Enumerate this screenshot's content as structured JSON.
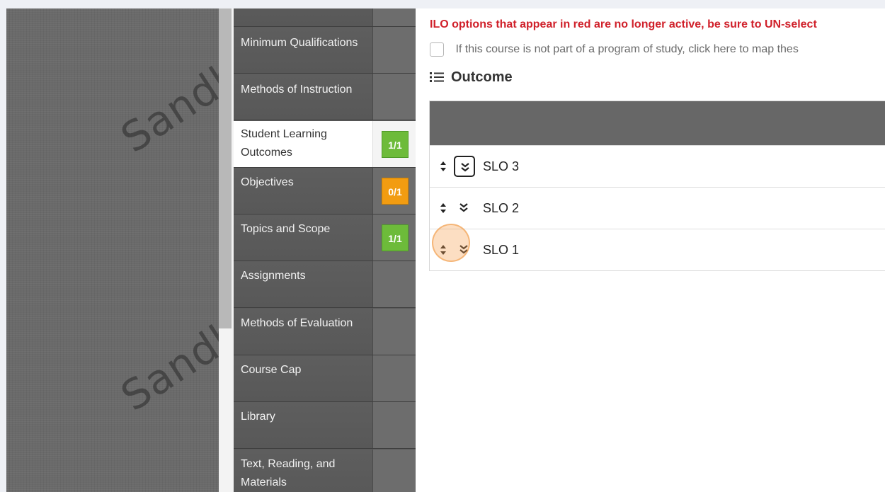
{
  "watermark": {
    "text": "Sandbo"
  },
  "nav": {
    "items": [
      {
        "label": "Minimum Qualifications",
        "badge": null,
        "active": false
      },
      {
        "label": "Methods of Instruction",
        "badge": null,
        "active": false
      },
      {
        "label": "Student Learning Outcomes",
        "badge": "1/1",
        "badge_color": "#6dbb3a",
        "active": true
      },
      {
        "label": "Objectives",
        "badge": "0/1",
        "badge_color": "#f29c11",
        "active": false
      },
      {
        "label": "Topics and Scope",
        "badge": "1/1",
        "badge_color": "#6dbb3a",
        "active": false
      },
      {
        "label": "Assignments",
        "badge": null,
        "active": false
      },
      {
        "label": "Methods of Evaluation",
        "badge": null,
        "active": false
      },
      {
        "label": "Course Cap",
        "badge": null,
        "active": false
      },
      {
        "label": "Library",
        "badge": null,
        "active": false
      },
      {
        "label": "Text, Reading, and Materials",
        "badge": null,
        "active": false
      }
    ]
  },
  "main": {
    "notice": "ILO options that appear in red are no longer active, be sure to UN-select",
    "map_checkbox_label": "If this course is not part of a program of study, click here to map thes",
    "map_checkbox_checked": false,
    "outcome_heading": "Outcome",
    "rows": [
      {
        "label": "SLO 3",
        "expand_focused": true
      },
      {
        "label": "SLO 2",
        "expand_focused": false
      },
      {
        "label": "SLO 1",
        "expand_focused": false
      }
    ]
  },
  "colors": {
    "notice_red": "#d0202a",
    "header_gray": "#676767",
    "badge_green": "#6dbb3a",
    "badge_orange": "#f29c11",
    "click_highlight": "#f7a050"
  },
  "icons": {
    "sort": "sort-arrows-icon",
    "expand": "double-chevron-down-icon",
    "list": "list-icon"
  }
}
